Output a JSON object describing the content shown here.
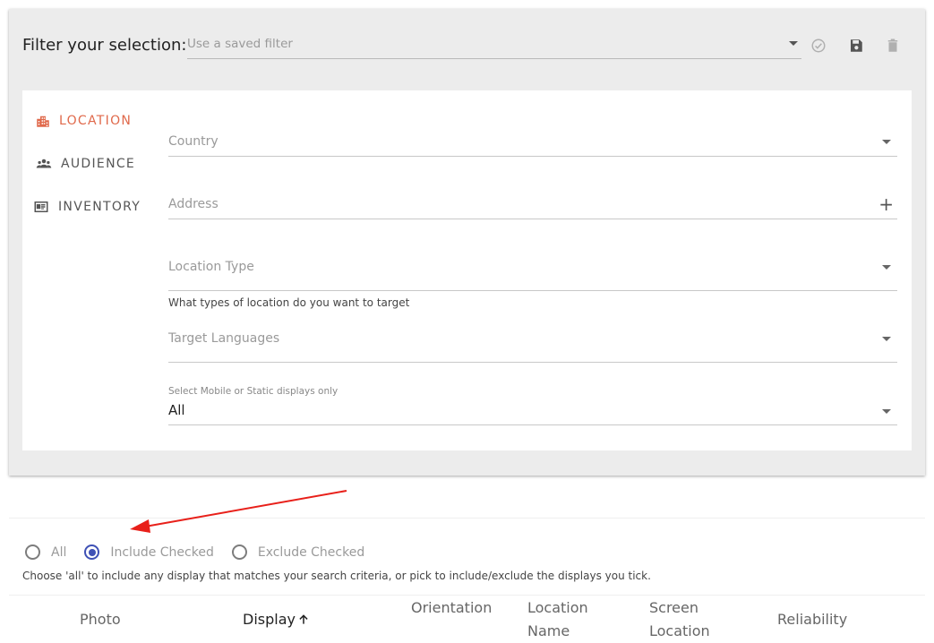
{
  "filter": {
    "title": "Filter your selection:",
    "saved_filter_placeholder": "Use a saved filter"
  },
  "nav": {
    "items": [
      {
        "label": "LOCATION",
        "icon": "building-icon",
        "active": true
      },
      {
        "label": "AUDIENCE",
        "icon": "people-icon",
        "active": false
      },
      {
        "label": "INVENTORY",
        "icon": "inventory-icon",
        "active": false
      }
    ]
  },
  "fields": {
    "country_placeholder": "Country",
    "address_placeholder": "Address",
    "location_type_placeholder": "Location Type",
    "location_type_hint": "What types of location do you want to target",
    "target_languages_placeholder": "Target Languages",
    "display_type_label": "Select Mobile or Static displays only",
    "display_type_value": "All"
  },
  "selection_mode": {
    "options": [
      "All",
      "Include Checked",
      "Exclude Checked"
    ],
    "selected": "Include Checked",
    "help": "Choose 'all' to include any display that matches your search criteria, or pick to include/exclude the displays you tick."
  },
  "table": {
    "columns": {
      "photo": "Photo",
      "display": "Display",
      "orientation": "Orientation",
      "location_name_1": "Location",
      "location_name_2": "Name",
      "screen_location_1": "Screen",
      "screen_location_2": "Location",
      "reliability": "Reliability"
    }
  },
  "colors": {
    "accent": "#e0694b",
    "radio_selected": "#3f51b5",
    "annotation_arrow": "#e8201a"
  }
}
